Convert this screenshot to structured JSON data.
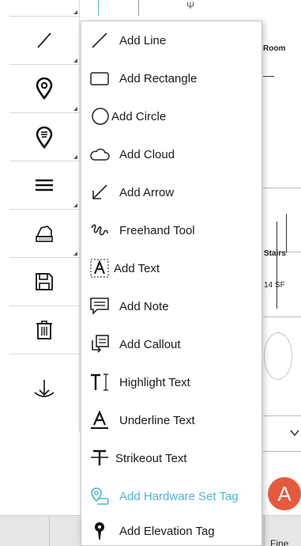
{
  "canvas": {
    "room_label": "Room",
    "stairs_label": "Stairs",
    "area_label": "14 SF",
    "fine_label": "Fine"
  },
  "rail": [
    {
      "name": "line-tool-button",
      "icon": "line-icon"
    },
    {
      "name": "pin-tool-button",
      "icon": "location-pin-icon"
    },
    {
      "name": "tag-pin-tool-button",
      "icon": "list-pin-icon"
    },
    {
      "name": "menu-tool-button",
      "icon": "hamburger-icon"
    },
    {
      "name": "stamp-tool-button",
      "icon": "stamp-icon"
    },
    {
      "name": "save-tool-button",
      "icon": "save-icon"
    },
    {
      "name": "delete-tool-button",
      "icon": "trash-icon"
    },
    {
      "name": "download-tool-button",
      "icon": "download-icon"
    }
  ],
  "menu": {
    "items": [
      {
        "label": "Add Line",
        "icon": "line-icon"
      },
      {
        "label": "Add Rectangle",
        "icon": "rectangle-icon"
      },
      {
        "label": "Add Circle",
        "icon": "circle-icon"
      },
      {
        "label": "Add Cloud",
        "icon": "cloud-icon"
      },
      {
        "label": "Add Arrow",
        "icon": "arrow-icon"
      },
      {
        "label": "Freehand Tool",
        "icon": "freehand-icon"
      },
      {
        "label": "Add Text",
        "icon": "text-box-icon"
      },
      {
        "label": "Add Note",
        "icon": "note-icon"
      },
      {
        "label": "Add Callout",
        "icon": "callout-icon"
      },
      {
        "label": "Highlight Text",
        "icon": "highlight-text-icon"
      },
      {
        "label": "Underline Text",
        "icon": "underline-icon"
      },
      {
        "label": "Strikeout Text",
        "icon": "strikeout-icon"
      },
      {
        "label": "Add Hardware Set Tag",
        "icon": "hardware-tag-icon"
      },
      {
        "label": "Add Elevation Tag",
        "icon": "elevation-pin-icon"
      }
    ]
  },
  "avatar": {
    "initial": "A",
    "color": "#e65a3b"
  },
  "colors": {
    "accent": "#4fb3d9",
    "menu_text": "#1a1a1a"
  }
}
